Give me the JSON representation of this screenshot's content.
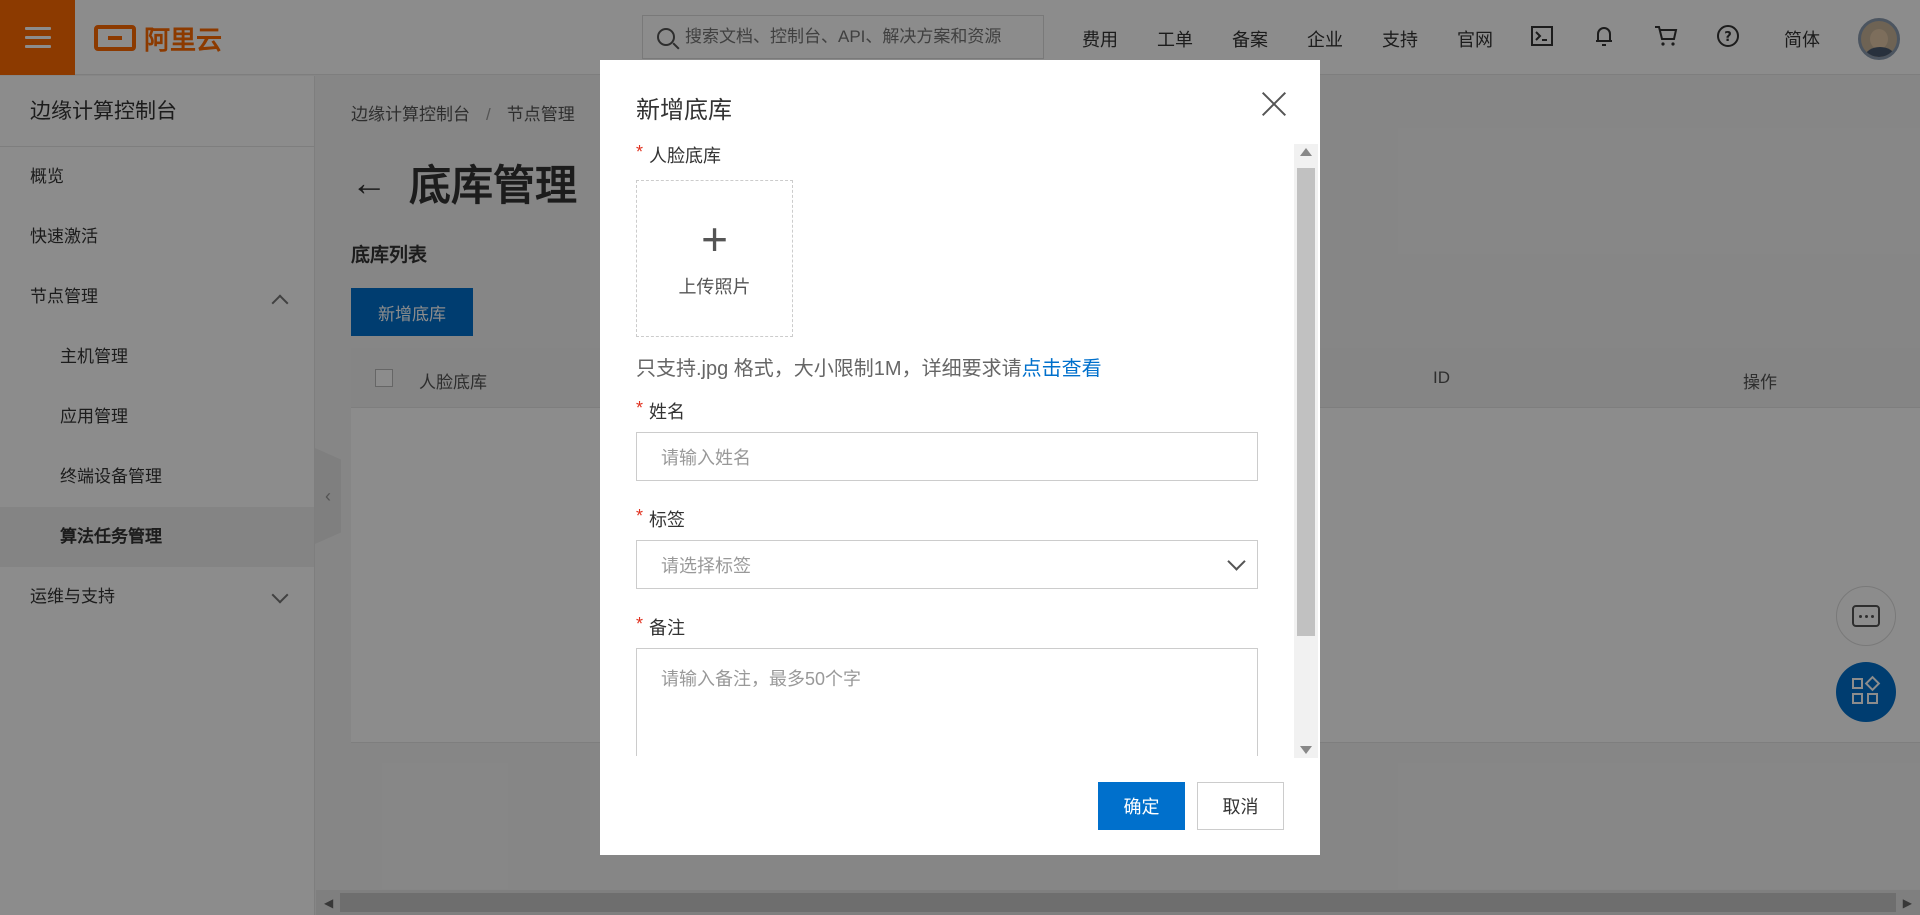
{
  "header": {
    "logo_text": "阿里云",
    "search_placeholder": "搜索文档、控制台、API、解决方案和资源",
    "nav": [
      "费用",
      "工单",
      "备案",
      "企业",
      "支持",
      "官网"
    ],
    "lang": "简体"
  },
  "sidebar": {
    "title": "边缘计算控制台",
    "items": [
      {
        "label": "概览"
      },
      {
        "label": "快速激活"
      },
      {
        "label": "节点管理"
      },
      {
        "label": "主机管理"
      },
      {
        "label": "应用管理"
      },
      {
        "label": "终端设备管理"
      },
      {
        "label": "算法任务管理"
      },
      {
        "label": "运维与支持"
      }
    ]
  },
  "main": {
    "breadcrumb": [
      "边缘计算控制台",
      "/",
      "节点管理"
    ],
    "page_title": "底库管理",
    "section_title": "底库列表",
    "new_button": "新增底库",
    "table_headers": [
      "人脸底库",
      "ID",
      "操作"
    ]
  },
  "modal": {
    "title": "新增底库",
    "face_label": "人脸底库",
    "upload_label": "上传照片",
    "hint_text": "只支持.jpg 格式，大小限制1M，详细要求请",
    "hint_link": "点击查看",
    "name_label": "姓名",
    "name_placeholder": "请输入姓名",
    "tag_label": "标签",
    "tag_placeholder": "请选择标签",
    "note_label": "备注",
    "note_placeholder": "请输入备注，最多50个字",
    "ok_label": "确定",
    "cancel_label": "取消"
  },
  "colors": {
    "brand": "#ff6a00",
    "primary": "#0070cc",
    "required": "#e0301e"
  }
}
